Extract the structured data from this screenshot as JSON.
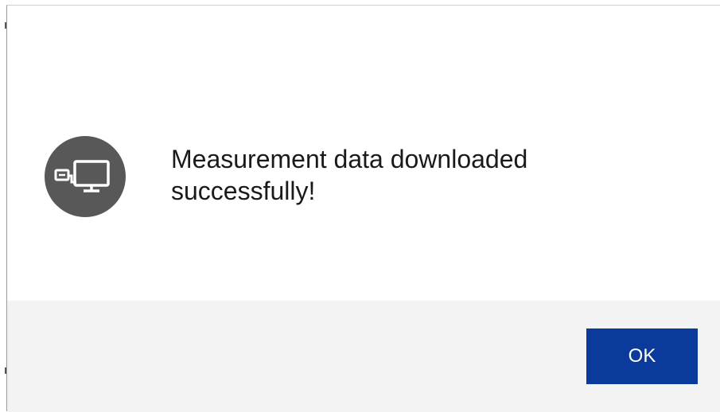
{
  "dialog": {
    "icon": "network-computer-icon",
    "message_line1": "Measurement data downloaded",
    "message_line2": "successfully!",
    "ok_label": "OK"
  },
  "colors": {
    "icon_background": "#585858",
    "footer_background": "#f3f3f3",
    "button_background": "#0a3a9c",
    "button_text": "#ffffff"
  }
}
